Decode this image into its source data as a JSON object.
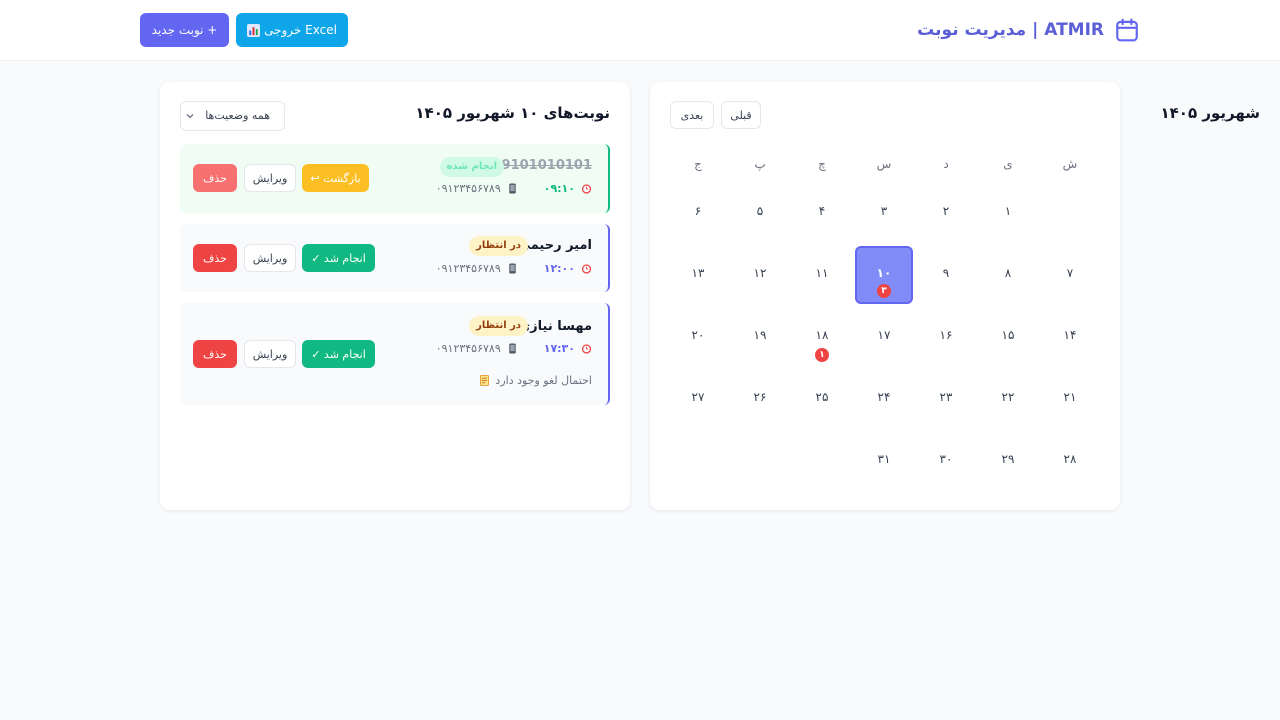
{
  "header": {
    "title": "ATMIR | مدیریت نوبت",
    "new_button": "+ نوبت جدید",
    "excel_button": "خروجی Excel"
  },
  "calendar": {
    "title": "شهریور ۱۴۰۵",
    "prev_label": "قبلی",
    "next_label": "بعدی",
    "weekdays": [
      "ش",
      "ی",
      "د",
      "س",
      "چ",
      "پ",
      "ج"
    ],
    "start_offset": 1,
    "days": [
      "۱",
      "۲",
      "۳",
      "۴",
      "۵",
      "۶",
      "۷",
      "۸",
      "۹",
      "۱۰",
      "۱۱",
      "۱۲",
      "۱۳",
      "۱۴",
      "۱۵",
      "۱۶",
      "۱۷",
      "۱۸",
      "۱۹",
      "۲۰",
      "۲۱",
      "۲۲",
      "۲۳",
      "۲۴",
      "۲۵",
      "۲۶",
      "۲۷",
      "۲۸",
      "۲۹",
      "۳۰",
      "۳۱"
    ],
    "selected_day": 10,
    "counts": {
      "10": "۳",
      "18": "۱"
    }
  },
  "appointments_panel": {
    "title": "نوبت‌های ۱۰ شهریور ۱۴۰۵",
    "filter_label": "همه وضعیت‌ها",
    "items": [
      {
        "name": "09101010101",
        "status": "انجام شده",
        "time": "۰۹:۱۰",
        "phone": "۰۹۱۲۳۴۵۶۷۸۹",
        "note": "",
        "action_label": "↩ بازگشت",
        "edit_label": "ویرایش",
        "delete_label": "حذف"
      },
      {
        "name": "امیر رحیمی",
        "status": "در انتظار",
        "time": "۱۲:۰۰",
        "phone": "۰۹۱۲۳۴۵۶۷۸۹",
        "note": "",
        "action_label": "✓ انجام شد",
        "edit_label": "ویرایش",
        "delete_label": "حذف"
      },
      {
        "name": "مهسا نیازی",
        "status": "در انتظار",
        "time": "۱۷:۳۰",
        "phone": "۰۹۱۲۳۴۵۶۷۸۹",
        "note": "احتمال لغو وجود دارد",
        "action_label": "✓ انجام شد",
        "edit_label": "ویرایش",
        "delete_label": "حذف"
      }
    ]
  },
  "colors": {
    "accent": "#6366f1",
    "excel": "#0ea5e9",
    "success": "#10b981",
    "danger": "#ef4444",
    "warning": "#fbbf24"
  }
}
